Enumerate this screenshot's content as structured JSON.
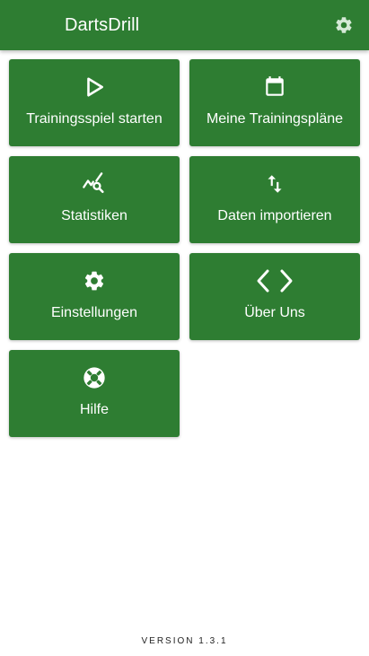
{
  "colors": {
    "primary": "#2e7d32",
    "on_primary": "#ffffff",
    "background": "#ffffff",
    "version_text": "#222222"
  },
  "header": {
    "title": "DartsDrill",
    "settings_icon": "gear-icon"
  },
  "menu": {
    "tiles": [
      {
        "label": "Trainingsspiel starten",
        "icon": "play-icon"
      },
      {
        "label": "Meine Trainingspläne",
        "icon": "calendar-icon"
      },
      {
        "label": "Statistiken",
        "icon": "chart-search-icon"
      },
      {
        "label": "Daten importieren",
        "icon": "swap-vertical-icon"
      },
      {
        "label": "Einstellungen",
        "icon": "gear-icon"
      },
      {
        "label": "Über Uns",
        "icon": "code-icon"
      },
      {
        "label": "Hilfe",
        "icon": "lifebuoy-icon"
      }
    ]
  },
  "footer": {
    "version": "VERSION 1.3.1"
  }
}
